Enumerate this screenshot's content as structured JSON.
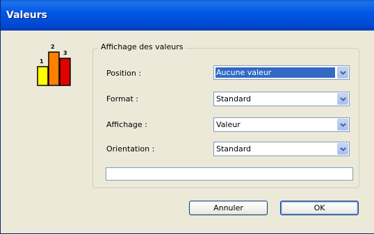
{
  "window": {
    "title": "Valeurs"
  },
  "group": {
    "legend": "Affichage des valeurs"
  },
  "fields": {
    "position": {
      "label": "Position :",
      "value": "Aucune valeur"
    },
    "format": {
      "label": "Format :",
      "value": "Standard"
    },
    "affichage": {
      "label": "Affichage :",
      "value": "Valeur"
    },
    "orientation": {
      "label": "Orientation :",
      "value": "Standard"
    }
  },
  "logo": {
    "icon": "bar-chart-values-icon",
    "bars": [
      "1",
      "2",
      "3"
    ],
    "colors": [
      "#ffff00",
      "#ff8000",
      "#e00000"
    ]
  },
  "buttons": {
    "cancel_label": "Annuler",
    "ok_label": "OK"
  },
  "colors": {
    "titlebar": "#0058e6",
    "dialog_bg": "#ece9d8",
    "selection": "#316ac5"
  }
}
